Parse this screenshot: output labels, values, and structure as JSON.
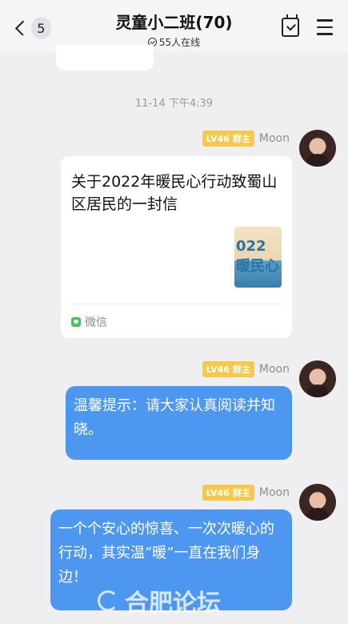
{
  "header": {
    "back_badge": "5",
    "title": "灵童小二班(70)",
    "online": "55人在线"
  },
  "timestamp": "11-14 下午4:39",
  "messages": [
    {
      "level": "LV46",
      "role": "群主",
      "sender": "Moon",
      "card": {
        "title": "关于2022年暖民心行动致蜀山区居民的一封信",
        "thumb_text": "022 暖民心",
        "source": "微信"
      }
    },
    {
      "level": "LV46",
      "role": "群主",
      "sender": "Moon",
      "text": "温馨提示：请大家认真阅读并知晓。"
    },
    {
      "level": "LV46",
      "role": "群主",
      "sender": "Moon",
      "text": "一个个安心的惊喜、一次次暖心的行动，其实温“暖”一直在我们身边！"
    }
  ],
  "watermark": "合肥论坛",
  "colors": {
    "bubble": "#4e97f0",
    "level_badge": "#f7c84a",
    "background": "#efeff1"
  }
}
